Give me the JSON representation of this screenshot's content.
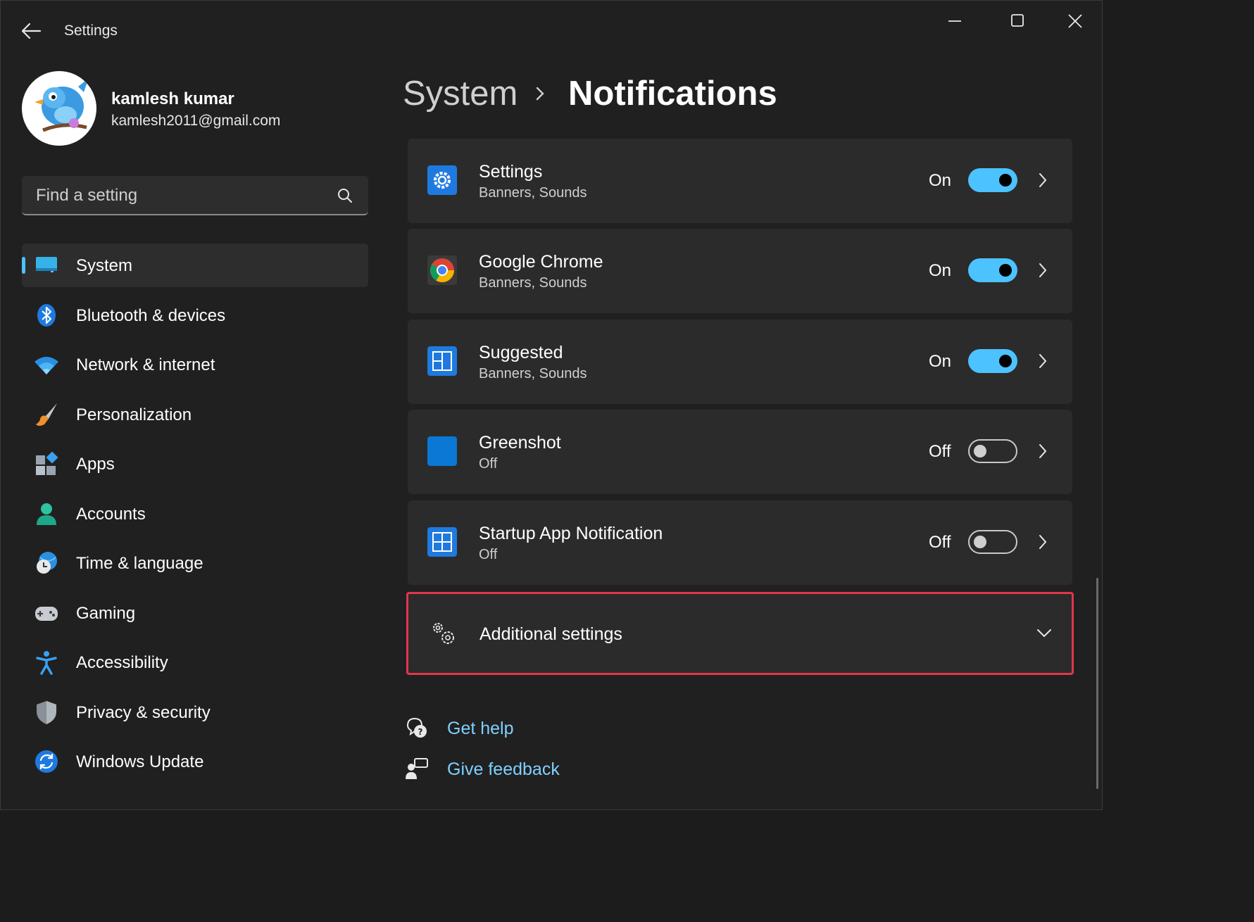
{
  "window": {
    "title": "Settings"
  },
  "profile": {
    "name": "kamlesh kumar",
    "email": "kamlesh2011@gmail.com"
  },
  "search": {
    "placeholder": "Find a setting"
  },
  "nav": {
    "items": [
      {
        "label": "System",
        "icon": "monitor-icon",
        "active": true
      },
      {
        "label": "Bluetooth & devices",
        "icon": "bluetooth-icon"
      },
      {
        "label": "Network & internet",
        "icon": "wifi-icon"
      },
      {
        "label": "Personalization",
        "icon": "brush-icon"
      },
      {
        "label": "Apps",
        "icon": "apps-icon"
      },
      {
        "label": "Accounts",
        "icon": "person-icon"
      },
      {
        "label": "Time & language",
        "icon": "globe-clock-icon"
      },
      {
        "label": "Gaming",
        "icon": "gamepad-icon"
      },
      {
        "label": "Accessibility",
        "icon": "accessibility-icon"
      },
      {
        "label": "Privacy & security",
        "icon": "shield-icon"
      },
      {
        "label": "Windows Update",
        "icon": "update-icon"
      }
    ]
  },
  "header": {
    "parent": "System",
    "current": "Notifications"
  },
  "apps": [
    {
      "name": "Settings",
      "sub": "Banners, Sounds",
      "state": "On",
      "enabled": true,
      "icon": "settings-gear-icon"
    },
    {
      "name": "Google Chrome",
      "sub": "Banners, Sounds",
      "state": "On",
      "enabled": true,
      "icon": "chrome-icon"
    },
    {
      "name": "Suggested",
      "sub": "Banners, Sounds",
      "state": "On",
      "enabled": true,
      "icon": "suggested-icon"
    },
    {
      "name": "Greenshot",
      "sub": "Off",
      "state": "Off",
      "enabled": false,
      "icon": "greenshot-icon"
    },
    {
      "name": "Startup App Notification",
      "sub": "Off",
      "state": "Off",
      "enabled": false,
      "icon": "startup-app-icon"
    }
  ],
  "additional": {
    "label": "Additional settings"
  },
  "links": {
    "help": "Get help",
    "feedback": "Give feedback"
  },
  "colors": {
    "accent": "#4cc2ff",
    "highlight_border": "#e0364c",
    "link": "#7fd0ff",
    "background": "#202020",
    "card": "#2b2b2b"
  }
}
